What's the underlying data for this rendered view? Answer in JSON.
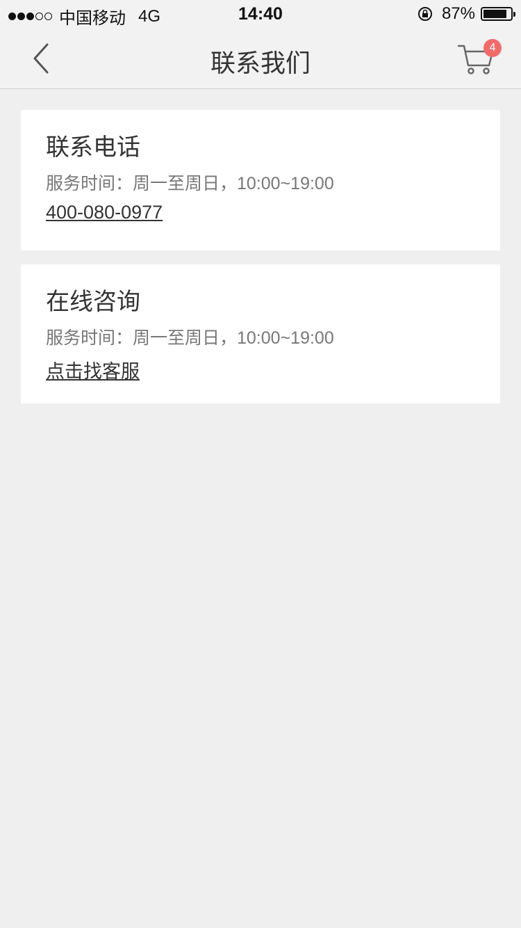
{
  "status_bar": {
    "carrier": "中国移动",
    "network": "4G",
    "time": "14:40",
    "battery": "87%",
    "battery_level": 0.87
  },
  "nav": {
    "title": "联系我们",
    "cart_badge": "4"
  },
  "contact_phone": {
    "title": "联系电话",
    "hours": "服务时间：周一至周日，10:00~19:00",
    "phone": "400-080-0977"
  },
  "contact_online": {
    "title": "在线咨询",
    "hours": "服务时间：周一至周日，10:00~19:00",
    "link": "点击找客服"
  },
  "colors": {
    "background": "#efefef",
    "badge": "#f26b6b"
  }
}
